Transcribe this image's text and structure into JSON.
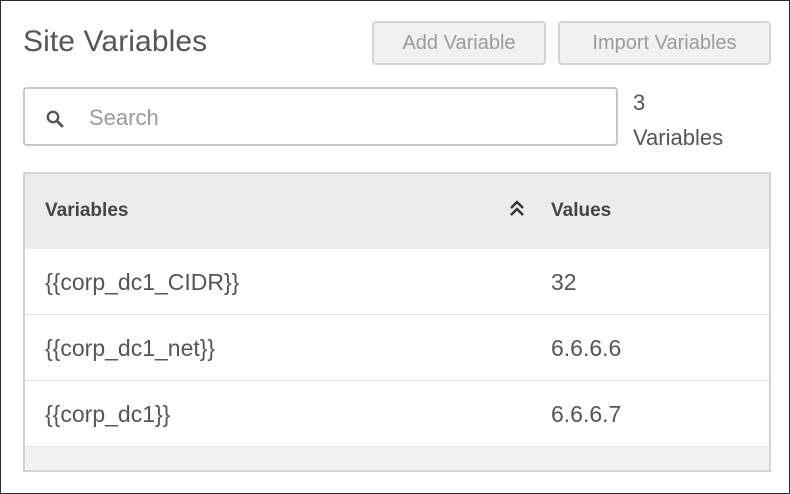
{
  "header": {
    "title": "Site Variables",
    "add_label": "Add Variable",
    "import_label": "Import Variables"
  },
  "search": {
    "placeholder": "Search",
    "value": ""
  },
  "count": {
    "number": "3",
    "label": "Variables"
  },
  "table": {
    "columns": [
      "Variables",
      "Values"
    ],
    "rows": [
      [
        "{{corp_dc1_CIDR}}",
        "32"
      ],
      [
        "{{corp_dc1_net}}",
        "6.6.6.6"
      ],
      [
        "{{corp_dc1}}",
        "6.6.6.7"
      ]
    ],
    "sort_icon": "double-chevron-up-icon"
  }
}
